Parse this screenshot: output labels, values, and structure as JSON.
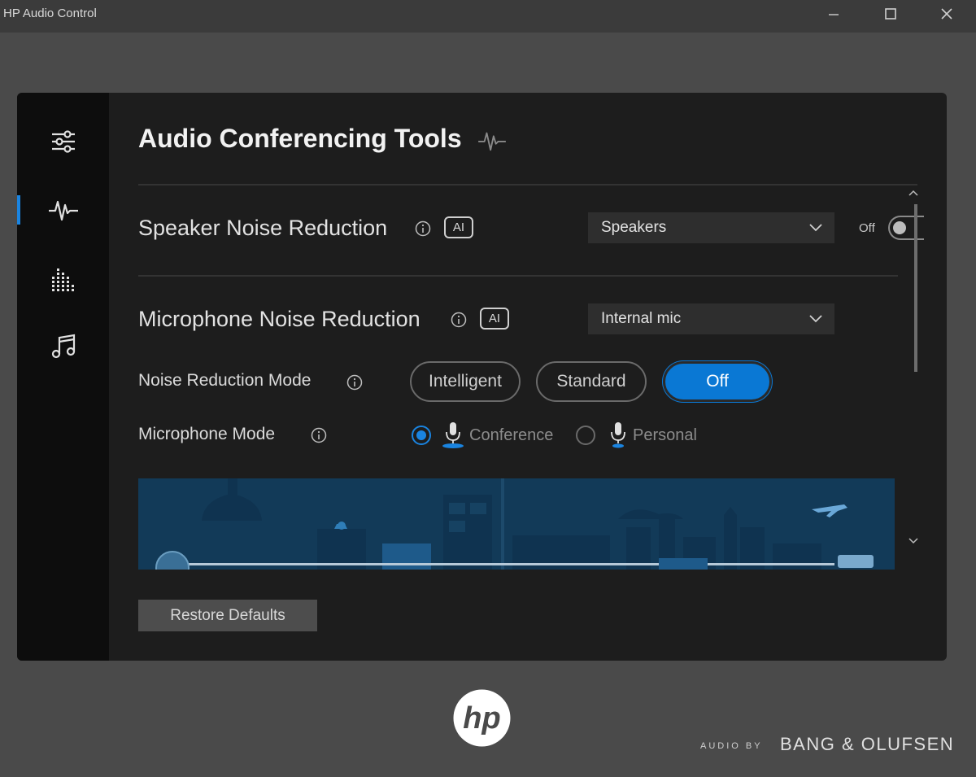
{
  "window": {
    "title": "HP Audio Control"
  },
  "colors": {
    "accent": "#0a78d4",
    "panel": "#1d1d1d",
    "sidebar": "#0d0d0d",
    "background": "#4a4a4a"
  },
  "sidebar": {
    "items": [
      {
        "icon": "sliders-icon",
        "active": false
      },
      {
        "icon": "waveform-icon",
        "active": true
      },
      {
        "icon": "equalizer-icon",
        "active": false
      },
      {
        "icon": "music-note-icon",
        "active": false
      }
    ]
  },
  "page": {
    "title": "Audio Conferencing Tools",
    "title_icon": "waveform-icon"
  },
  "speaker_noise": {
    "label": "Speaker Noise Reduction",
    "badge": "AI",
    "device": "Speakers",
    "toggle_label": "Off",
    "toggle_on": false
  },
  "mic_noise": {
    "label": "Microphone Noise Reduction",
    "badge": "AI",
    "device": "Internal mic"
  },
  "noise_mode": {
    "label": "Noise Reduction Mode",
    "options": [
      "Intelligent",
      "Standard",
      "Off"
    ],
    "selected": "Off"
  },
  "mic_mode": {
    "label": "Microphone Mode",
    "options": [
      "Conference",
      "Personal"
    ],
    "selected": "Conference"
  },
  "footer": {
    "restore_label": "Restore Defaults",
    "brand_prefix": "AUDIO BY",
    "brand_name": "BANG & OLUFSEN",
    "logo_text": "hp"
  }
}
